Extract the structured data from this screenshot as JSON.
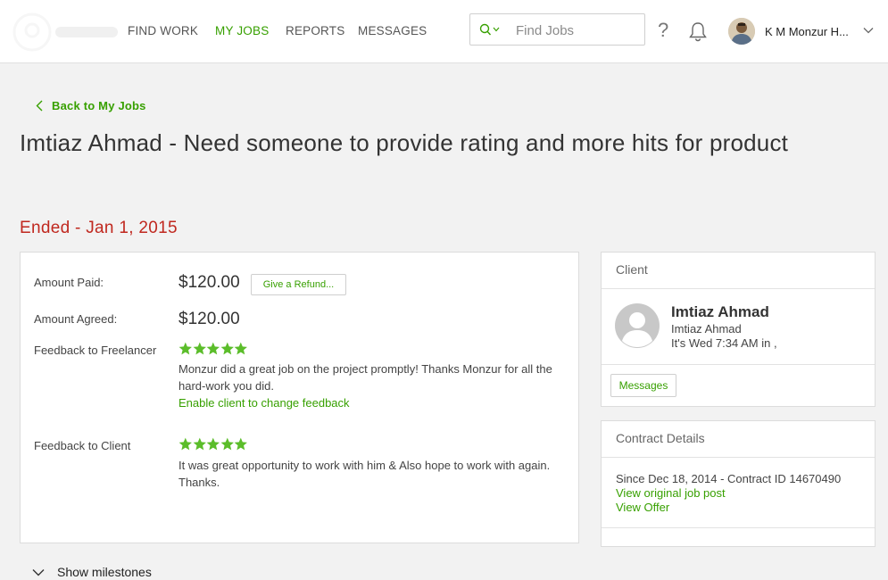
{
  "header": {
    "nav": [
      {
        "label": "FIND WORK",
        "active": false
      },
      {
        "label": "MY JOBS",
        "active": true
      },
      {
        "label": "REPORTS",
        "active": false
      },
      {
        "label": "MESSAGES",
        "active": false
      }
    ],
    "search": {
      "placeholder": "Find Jobs",
      "icon": "search-icon"
    },
    "help_label": "?",
    "user_name": "K M Monzur H..."
  },
  "back_link": "Back to My Jobs",
  "job_title": "Imtiaz Ahmad - Need someone to provide rating and more hits for product",
  "status": "Ended - Jan 1, 2015",
  "contract": {
    "amount_paid_label": "Amount Paid:",
    "amount_paid": "$120.00",
    "refund_button": "Give a Refund...",
    "amount_agreed_label": "Amount Agreed:",
    "amount_agreed": "$120.00",
    "feedback_freelancer_label": "Feedback to Freelancer",
    "feedback_freelancer_rating": 5,
    "feedback_freelancer_text": "Monzur did a great job on the project promptly! Thanks Monzur for all the hard-work you did.",
    "enable_feedback_link": "Enable client to change feedback",
    "feedback_client_label": "Feedback to Client",
    "feedback_client_rating": 5,
    "feedback_client_text": "It was great opportunity to work with him & Also hope to work with again. Thanks."
  },
  "client_card": {
    "title": "Client",
    "name": "Imtiaz Ahmad",
    "subname": "Imtiaz Ahmad",
    "local_time": "It's Wed 7:34 AM in ,",
    "messages_button": "Messages"
  },
  "contract_details": {
    "title": "Contract Details",
    "since_line": "Since Dec 18, 2014 - Contract ID 14670490",
    "view_job_post": "View original job post",
    "view_offer": "View Offer"
  },
  "show_milestones": "Show milestones",
  "colors": {
    "accent_green": "#37a000",
    "status_red": "#c0281f",
    "star_green": "#5bbd2a"
  }
}
